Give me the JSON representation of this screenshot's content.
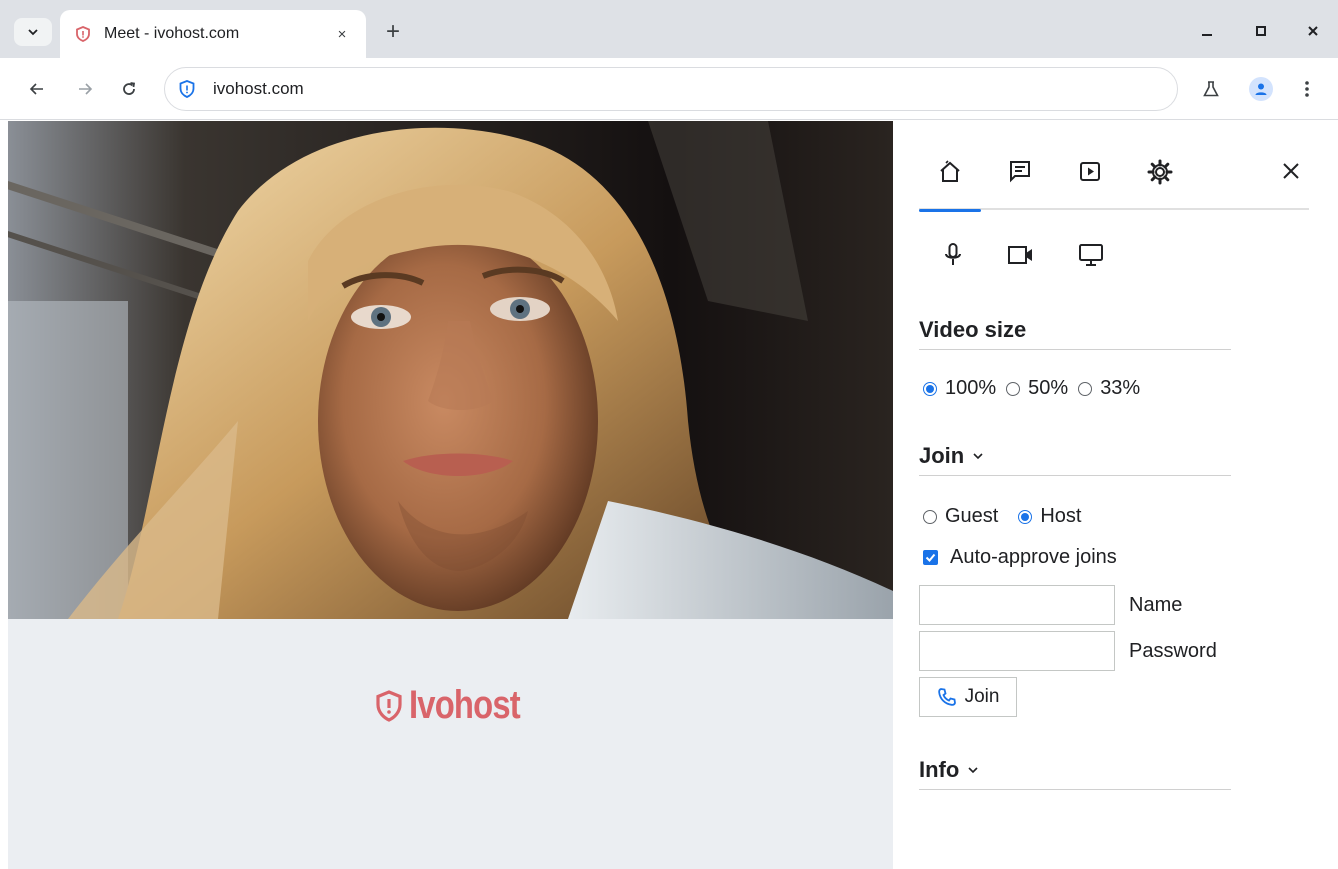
{
  "browser": {
    "tab_title": "Meet - ivohost.com",
    "tab_close": "×",
    "new_tab": "+",
    "url": "ivohost.com"
  },
  "brand": {
    "name": "Ivohost",
    "color": "#d9646a"
  },
  "panel": {
    "tabs": [
      "home",
      "chat",
      "media",
      "settings"
    ],
    "video_size": {
      "title": "Video size",
      "options": [
        {
          "label": "100%",
          "selected": true
        },
        {
          "label": "50%",
          "selected": false
        },
        {
          "label": "33%",
          "selected": false
        }
      ]
    },
    "join": {
      "title": "Join",
      "roles": [
        {
          "label": "Guest",
          "selected": false
        },
        {
          "label": "Host",
          "selected": true
        }
      ],
      "auto_approve_label": "Auto-approve joins",
      "auto_approve_checked": true,
      "name_label": "Name",
      "name_value": "",
      "password_label": "Password",
      "password_value": "",
      "join_button": "Join"
    },
    "info": {
      "title": "Info"
    }
  },
  "colors": {
    "accent": "#1a73e8",
    "stage_background": "#ebeef2"
  }
}
